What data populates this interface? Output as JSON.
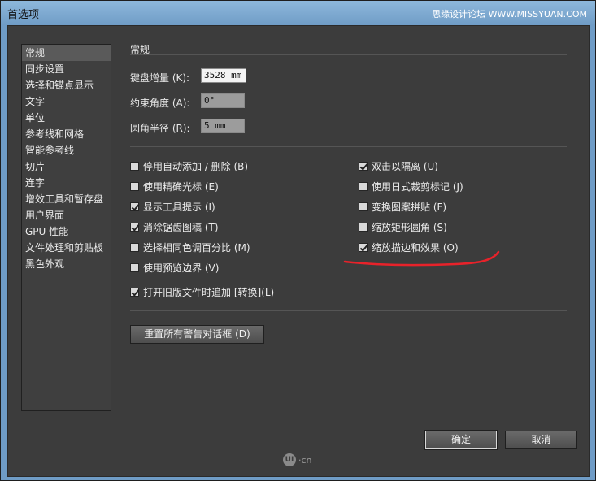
{
  "window": {
    "title": "首选项",
    "watermark": "思缘设计论坛 WWW.MISSYUAN.COM"
  },
  "sidebar": {
    "items": [
      "常规",
      "同步设置",
      "选择和锚点显示",
      "文字",
      "单位",
      "参考线和网格",
      "智能参考线",
      "切片",
      "连字",
      "增效工具和暂存盘",
      "用户界面",
      "GPU 性能",
      "文件处理和剪贴板",
      "黑色外观"
    ],
    "selected": 0
  },
  "general": {
    "section_title": "常规",
    "keyboard_increment": {
      "label": "键盘增量 (K):",
      "value": "3528 mm"
    },
    "constrain_angle": {
      "label": "约束角度 (A):",
      "value": "0°"
    },
    "corner_radius": {
      "label": "圆角半径 (R):",
      "value": "5 mm"
    }
  },
  "checkboxes_left": [
    {
      "label": "停用自动添加 / 删除 (B)",
      "checked": false
    },
    {
      "label": "使用精确光标 (E)",
      "checked": false
    },
    {
      "label": "显示工具提示 (I)",
      "checked": true
    },
    {
      "label": "消除锯齿图稿 (T)",
      "checked": true
    },
    {
      "label": "选择相同色调百分比 (M)",
      "checked": false
    },
    {
      "label": "使用预览边界 (V)",
      "checked": false
    }
  ],
  "checkboxes_right": [
    {
      "label": "双击以隔离 (U)",
      "checked": true
    },
    {
      "label": "使用日式裁剪标记 (J)",
      "checked": false
    },
    {
      "label": "变换图案拼贴 (F)",
      "checked": false
    },
    {
      "label": "缩放矩形圆角 (S)",
      "checked": false
    },
    {
      "label": "缩放描边和效果 (O)",
      "checked": true
    }
  ],
  "legacy_checkbox": {
    "label": "打开旧版文件时追加 [转换](L)",
    "checked": true
  },
  "buttons": {
    "reset_warnings": "重置所有警告对话框 (D)",
    "ok": "确定",
    "cancel": "取消"
  },
  "logo": {
    "text": "UI",
    "suffix": "·cn"
  },
  "colors": {
    "annotation": "#e8222a",
    "panel": "#3c3c3c"
  }
}
